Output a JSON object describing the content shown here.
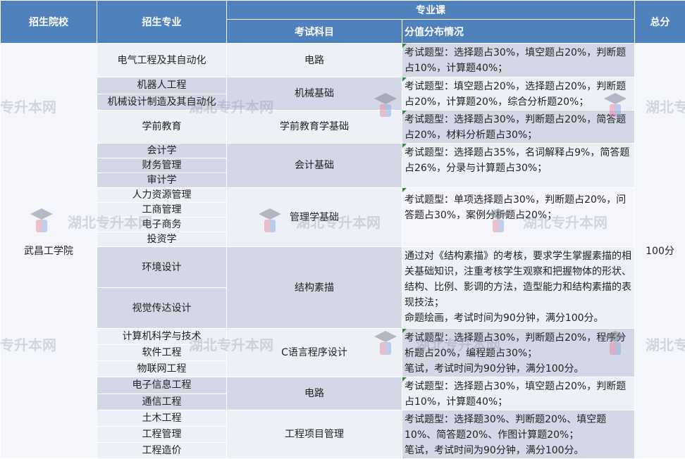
{
  "header": {
    "school": "招生院校",
    "major": "招生专业",
    "course_group": "专业课",
    "subject": "考试科目",
    "distribution": "分值分布情况",
    "total": "总分"
  },
  "school": "武昌工学院",
  "total": "100分",
  "groups": [
    {
      "majors": [
        "电气工程及其自动化"
      ],
      "subject": "电路",
      "dist": "考试题型：选择题占30%，填空题占20%，判断题占10%，计算题40%；"
    },
    {
      "majors": [
        "机器人工程",
        "机械设计制造及其自动化"
      ],
      "subject": "机械基础",
      "dist": "考试题型：填空题占20%，选择题占20%，判断题占20%，计算题20%，综合分析题20%；"
    },
    {
      "majors": [
        "学前教育"
      ],
      "subject": "学前教育学基础",
      "dist": "考试题型：选择题占30%，判断题占20%，简答题占20%，材料分析题占30%；"
    },
    {
      "majors": [
        "会计学",
        "财务管理",
        "审计学"
      ],
      "subject": "会计基础",
      "dist": "考试题型：选择题占35%，名词解释占9%，简答题占26%，分录与计算题占30%；"
    },
    {
      "majors": [
        "人力资源管理",
        "工商管理",
        "电子商务",
        "投资学"
      ],
      "subject": "管理学基础",
      "dist": "考试题型：单项选择题占30%，判断题占20%，问答题占30%，案例分析题占20%；"
    },
    {
      "majors": [
        "环境设计",
        "视觉传达设计"
      ],
      "subject": "结构素描",
      "dist": "通过对《结构素描》的考核，要求学生掌握素描的相关基础知识，注重考核学生观察和把握物体的形状、结构、比例、影调的方法，造型能力和结构素描的表现技法；\n命题绘画，考试时间为90分钟，满分100分。"
    },
    {
      "majors": [
        "计算机科学与技术",
        "软件工程",
        "物联网工程"
      ],
      "subject": "C语言程序设计",
      "dist": "考试题型：选择题占30%，判断题占20%，程序分析题占20%，编程题占30%；\n笔试，考试时间为90分钟，满分100分。"
    },
    {
      "majors": [
        "电子信息工程",
        "通信工程"
      ],
      "subject": "电路",
      "dist": "考试题型：选择题占30%，填空题占20%，判断题占10%，计算题40%；"
    },
    {
      "majors": [
        "土木工程",
        "工程管理",
        "工程造价"
      ],
      "subject": "工程项目管理",
      "dist": "考试题型：选择题30%、判断题20%、填空题10%、简答题20%、作图计算题20%；\n笔试，考试时间为90分钟，满分100分。"
    }
  ],
  "watermark": {
    "text": "湖北专升本网",
    "text_short": "专升本网",
    "text_edge": "湖北专"
  }
}
